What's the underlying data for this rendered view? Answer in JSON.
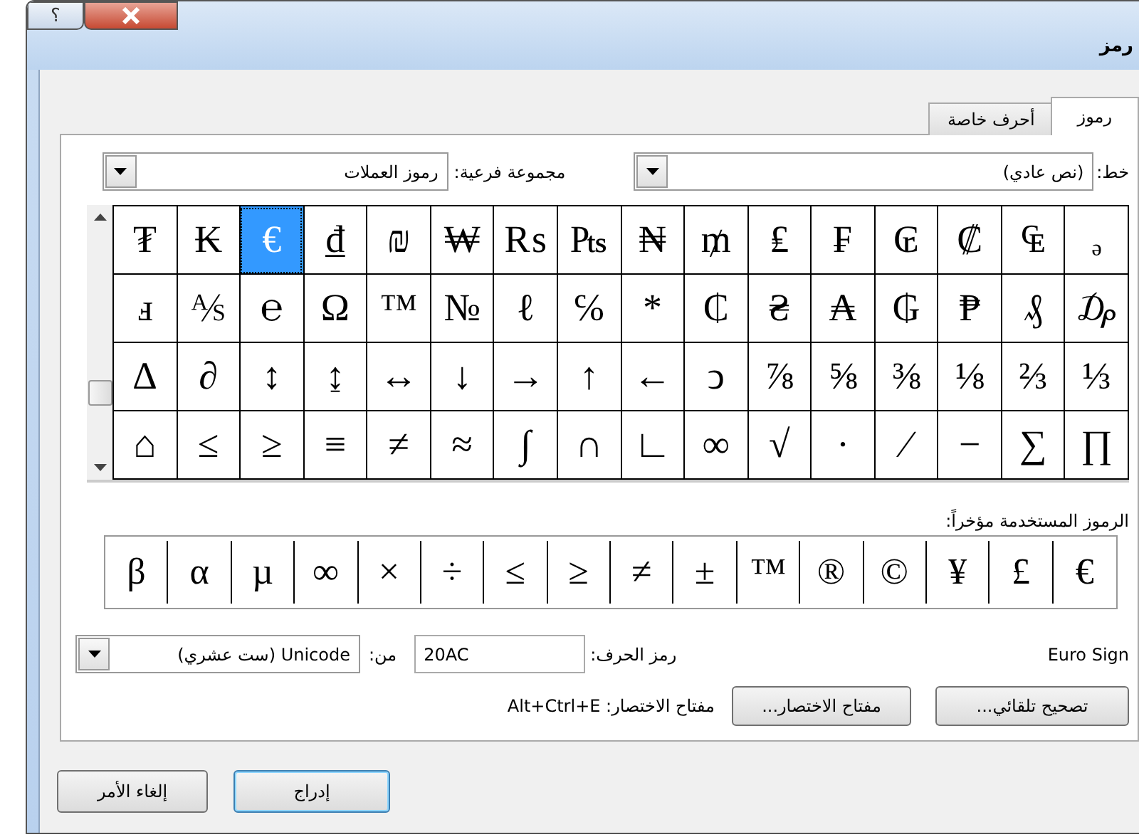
{
  "window": {
    "title": "رمز",
    "help_button": "؟"
  },
  "tabs": [
    {
      "label": "رموز",
      "selected": true
    },
    {
      "label": "أحرف خاصة",
      "selected": false
    }
  ],
  "font": {
    "label": "خط:",
    "value": "(نص عادي)"
  },
  "subset": {
    "label": "مجموعة فرعية:",
    "value": "رموز العملات"
  },
  "symbol_grid": {
    "rows": [
      [
        {
          "char": "ₔ",
          "selected": false
        },
        {
          "char": "₠",
          "selected": false
        },
        {
          "char": "₡",
          "selected": false
        },
        {
          "char": "₢",
          "selected": false
        },
        {
          "char": "₣",
          "selected": false
        },
        {
          "char": "₤",
          "selected": false
        },
        {
          "char": "₥",
          "selected": false
        },
        {
          "char": "₦",
          "selected": false
        },
        {
          "char": "₧",
          "selected": false
        },
        {
          "char": "₨",
          "selected": false
        },
        {
          "char": "₩",
          "selected": false
        },
        {
          "char": "₪",
          "selected": false
        },
        {
          "char": "₫",
          "selected": false
        },
        {
          "char": "€",
          "selected": true
        },
        {
          "char": "₭",
          "selected": false
        },
        {
          "char": "₮",
          "selected": false
        }
      ],
      [
        {
          "char": "₯",
          "selected": false
        },
        {
          "char": "₰",
          "selected": false
        },
        {
          "char": "₱",
          "selected": false
        },
        {
          "char": "₲",
          "selected": false
        },
        {
          "char": "₳",
          "selected": false
        },
        {
          "char": "₴",
          "selected": false
        },
        {
          "char": "₵",
          "selected": false
        },
        {
          "char": "*",
          "selected": false
        },
        {
          "char": "℅",
          "selected": false
        },
        {
          "char": "ℓ",
          "selected": false
        },
        {
          "char": "№",
          "selected": false
        },
        {
          "char": "™",
          "selected": false
        },
        {
          "char": "Ω",
          "selected": false
        },
        {
          "char": "℮",
          "selected": false
        },
        {
          "char": "⅍",
          "selected": false
        },
        {
          "char": "ⅎ",
          "selected": false
        }
      ],
      [
        {
          "char": "⅓",
          "selected": false
        },
        {
          "char": "⅔",
          "selected": false
        },
        {
          "char": "⅛",
          "selected": false
        },
        {
          "char": "⅜",
          "selected": false
        },
        {
          "char": "⅝",
          "selected": false
        },
        {
          "char": "⅞",
          "selected": false
        },
        {
          "char": "ↄ",
          "selected": false
        },
        {
          "char": "←",
          "selected": false
        },
        {
          "char": "↑",
          "selected": false
        },
        {
          "char": "→",
          "selected": false
        },
        {
          "char": "↓",
          "selected": false
        },
        {
          "char": "↔",
          "selected": false
        },
        {
          "char": "↨",
          "selected": false
        },
        {
          "char": "↕",
          "selected": false
        },
        {
          "char": "∂",
          "selected": false
        },
        {
          "char": "∆",
          "selected": false
        }
      ],
      [
        {
          "char": "∏",
          "selected": false
        },
        {
          "char": "∑",
          "selected": false
        },
        {
          "char": "−",
          "selected": false
        },
        {
          "char": "∕",
          "selected": false
        },
        {
          "char": "∙",
          "selected": false
        },
        {
          "char": "√",
          "selected": false
        },
        {
          "char": "∞",
          "selected": false
        },
        {
          "char": "∟",
          "selected": false
        },
        {
          "char": "∩",
          "selected": false
        },
        {
          "char": "∫",
          "selected": false
        },
        {
          "char": "≈",
          "selected": false
        },
        {
          "char": "≠",
          "selected": false
        },
        {
          "char": "≡",
          "selected": false
        },
        {
          "char": "≥",
          "selected": false
        },
        {
          "char": "≤",
          "selected": false
        },
        {
          "char": "⌂",
          "selected": false
        }
      ]
    ]
  },
  "recent": {
    "label": "الرموز المستخدمة مؤخراً:",
    "symbols": [
      "€",
      "£",
      "¥",
      "©",
      "®",
      "™",
      "±",
      "≠",
      "≥",
      "≤",
      "÷",
      "×",
      "∞",
      "µ",
      "α",
      "β"
    ]
  },
  "char_name": "Euro Sign",
  "char_code": {
    "label": "رمز الحرف:",
    "value": "20AC"
  },
  "from": {
    "label": "من:",
    "value": "Unicode (ست عشري)"
  },
  "autocorrect_button": "تصحيح تلقائي...",
  "shortcut_key_button": "مفتاح الاختصار...",
  "shortcut_text": "مفتاح الاختصار: Alt+Ctrl+E",
  "buttons": [
    {
      "label": "إدراج",
      "default": true
    },
    {
      "label": "إلغاء الأمر",
      "default": false
    }
  ]
}
